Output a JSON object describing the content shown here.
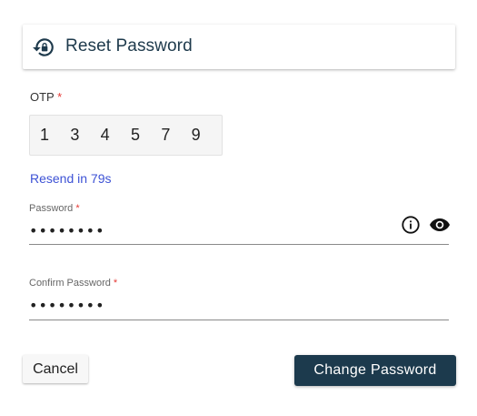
{
  "header": {
    "title": "Reset Password",
    "icon": "lock-reset-icon"
  },
  "otp": {
    "label": "OTP",
    "required_mark": "*",
    "digits": [
      "1",
      "3",
      "4",
      "5",
      "7",
      "9"
    ],
    "resend_text": "Resend in 79s"
  },
  "password": {
    "label": "Password",
    "required_mark": "*",
    "value": "••••••••",
    "info_icon": "info-icon",
    "visibility_icon": "eye-icon"
  },
  "confirm_password": {
    "label": "Confirm Password",
    "required_mark": "*",
    "value": "••••••••"
  },
  "actions": {
    "cancel_label": "Cancel",
    "submit_label": "Change Password"
  },
  "colors": {
    "accent": "#1c3a4d",
    "link": "#3d52d5",
    "required": "#e53935"
  }
}
